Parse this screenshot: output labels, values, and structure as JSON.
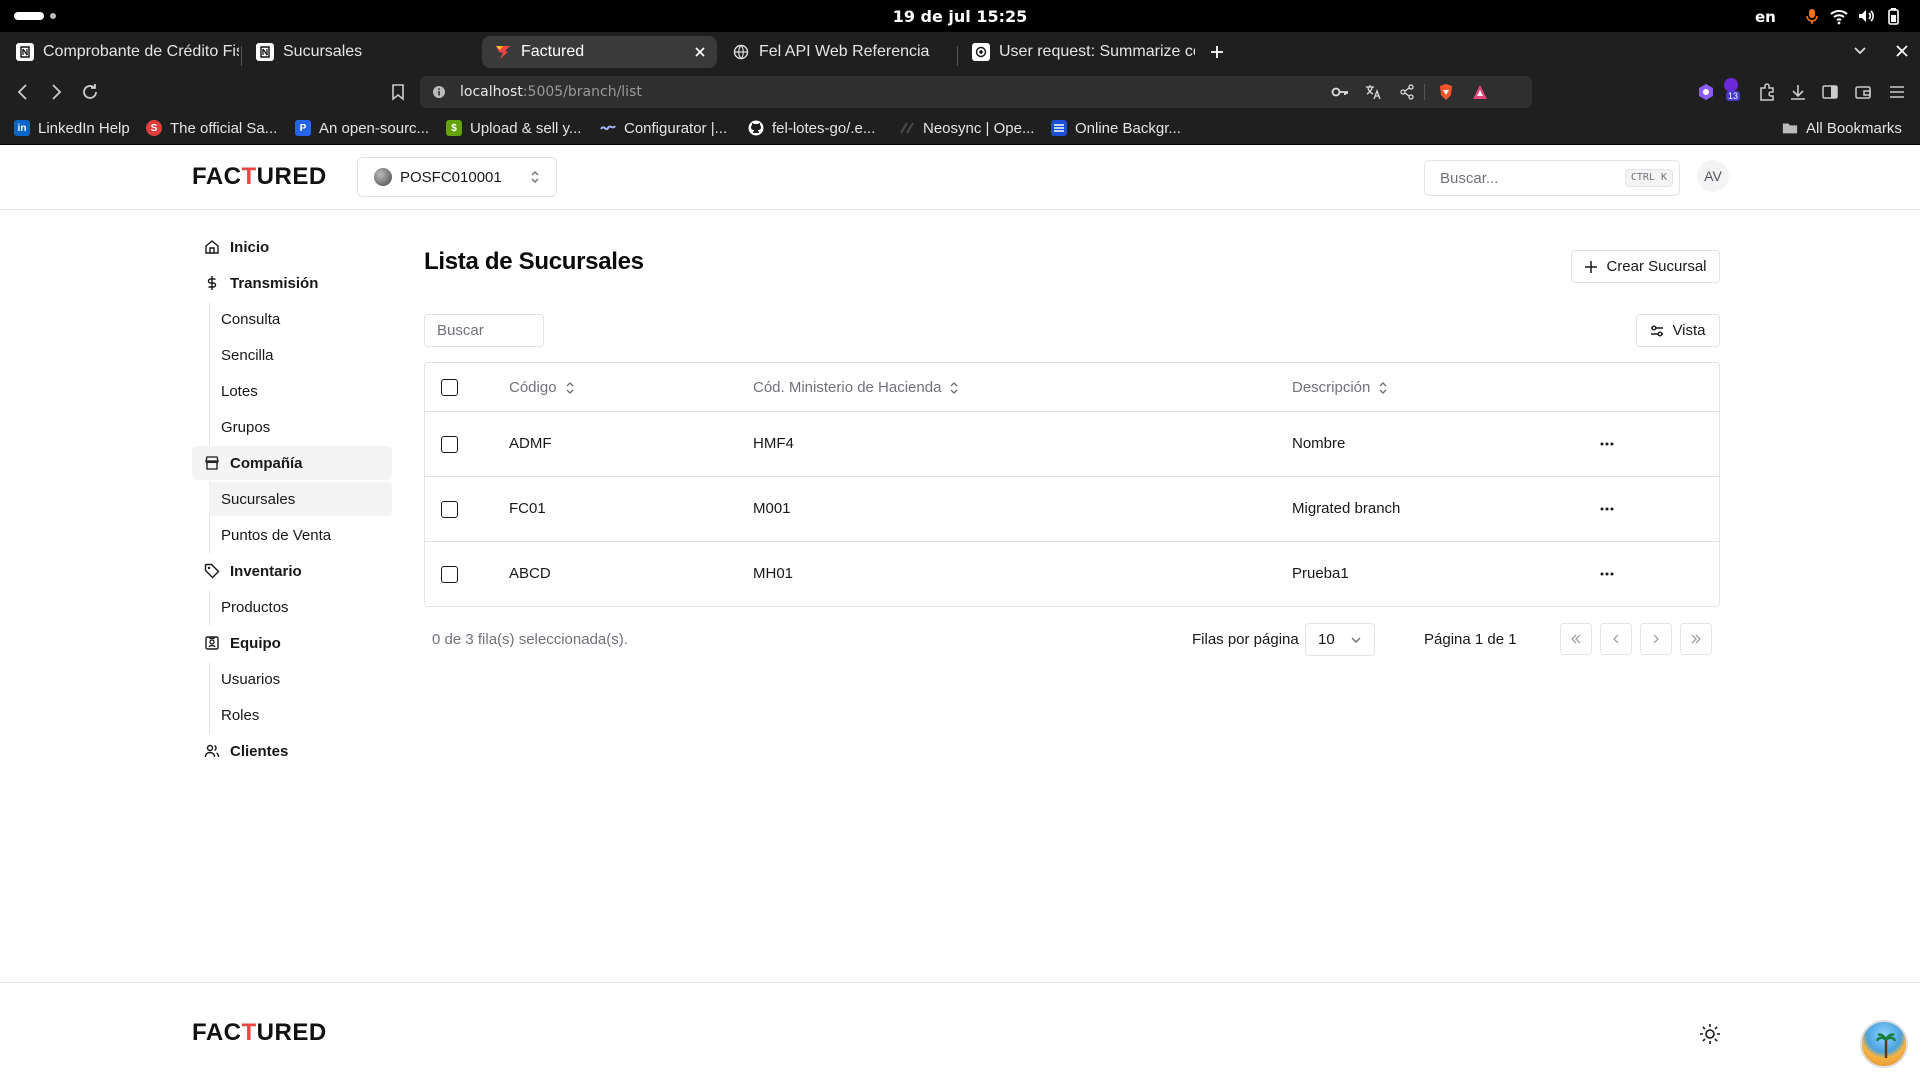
{
  "os": {
    "clock": "19 de jul  15:25",
    "lang": "en"
  },
  "browser": {
    "tabs": [
      {
        "title": "Comprobante de Crédito Fisc",
        "active": false
      },
      {
        "title": "Sucursales",
        "active": false
      },
      {
        "title": "Factured",
        "active": true
      },
      {
        "title": "Fel API Web Referencia",
        "active": false
      },
      {
        "title": "User request: Summarize con",
        "active": false
      }
    ],
    "url_host": "localhost",
    "url_rest": ":5005/branch/list",
    "bookmarks": [
      "LinkedIn Help",
      "The official Sa...",
      "An open-sourc...",
      "Upload & sell y...",
      "Configurator |...",
      "fel-lotes-go/.e...",
      "Neosync | Ope...",
      "Online Backgr..."
    ],
    "all_bookmarks": "All Bookmarks",
    "extension_badge": "13"
  },
  "header": {
    "logo_left": "FAC",
    "logo_mid": "T",
    "logo_right": "URED",
    "pos_name": "POSFC010001",
    "search_placeholder": "Buscar...",
    "search_kbd": "CTRL K",
    "avatar": "AV"
  },
  "sidebar": {
    "items": [
      {
        "label": "Inicio",
        "icon": "home-icon"
      },
      {
        "label": "Transmisión",
        "icon": "dollar-icon"
      },
      {
        "label": "Compañía",
        "icon": "store-icon"
      },
      {
        "label": "Inventario",
        "icon": "tag-icon"
      },
      {
        "label": "Equipo",
        "icon": "badge-icon"
      },
      {
        "label": "Clientes",
        "icon": "users-icon"
      }
    ],
    "transmision_sub": [
      "Consulta",
      "Sencilla",
      "Lotes",
      "Grupos"
    ],
    "compania_sub": [
      "Sucursales",
      "Puntos de Venta"
    ],
    "inventario_sub": [
      "Productos"
    ],
    "equipo_sub": [
      "Usuarios",
      "Roles"
    ]
  },
  "main": {
    "title": "Lista de Sucursales",
    "create_button": "Crear Sucursal",
    "filter_placeholder": "Buscar",
    "view_button": "Vista",
    "columns": [
      "Código",
      "Cód. Ministerio de Hacienda",
      "Descripción"
    ],
    "rows": [
      {
        "codigo": "ADMF",
        "cod_mh": "HMF4",
        "descripcion": "Nombre"
      },
      {
        "codigo": "FC01",
        "cod_mh": "M001",
        "descripcion": "Migrated branch"
      },
      {
        "codigo": "ABCD",
        "cod_mh": "MH01",
        "descripcion": "Prueba1"
      }
    ],
    "selection_text": "0 de 3 fila(s) seleccionada(s).",
    "rows_per_page_label": "Filas por página",
    "rows_per_page": "10",
    "page_info": "Página 1 de 1"
  },
  "colors": {
    "accent": "#ef4444",
    "border": "#e4e4e7",
    "muted": "#71717a",
    "text": "#18181b"
  }
}
